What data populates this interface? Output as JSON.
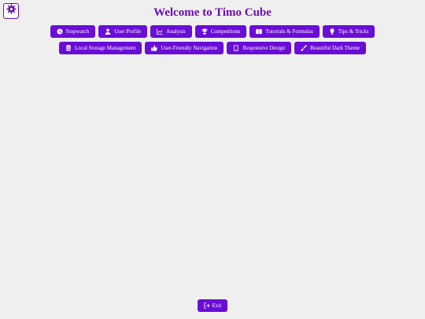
{
  "header": {
    "title": "Welcome to Timo Cube",
    "settings_icon": "gear-icon"
  },
  "nav": {
    "items": [
      {
        "id": "stopwatch",
        "label": "Stopwatch",
        "icon": "clock-icon"
      },
      {
        "id": "user-profile",
        "label": "User Profile",
        "icon": "user-icon"
      },
      {
        "id": "analysis",
        "label": "Analysis",
        "icon": "chart-line-icon"
      },
      {
        "id": "competitions",
        "label": "Competitions",
        "icon": "trophy-icon"
      },
      {
        "id": "tutorials",
        "label": "Tutorials & Formulas",
        "icon": "book-icon"
      },
      {
        "id": "tips",
        "label": "Tips & Tricks",
        "icon": "lightbulb-icon"
      },
      {
        "id": "storage",
        "label": "Local Storage Management",
        "icon": "database-icon"
      },
      {
        "id": "navigation",
        "label": "User-Friendly Navigation",
        "icon": "thumbs-up-icon"
      },
      {
        "id": "responsive",
        "label": "Responsive Design",
        "icon": "mobile-icon"
      },
      {
        "id": "dark-theme",
        "label": "Beautiful Dark Theme",
        "icon": "paint-brush-icon"
      }
    ]
  },
  "footer": {
    "exit_label": "Exit",
    "exit_icon": "sign-out-icon"
  },
  "colors": {
    "accent": "#6a0dd6",
    "title": "#6a0dad",
    "background": "#f0eff0"
  }
}
